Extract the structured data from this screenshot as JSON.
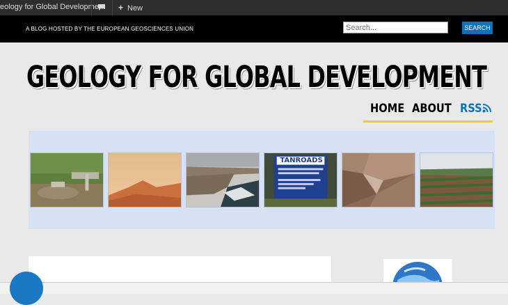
{
  "adminbar": {
    "site_name": "eology for Global Development",
    "comments_icon": "speech-bubble-icon",
    "new_icon": "plus-icon",
    "new_label": "New"
  },
  "header": {
    "tagline": "A BLOG HOSTED BY THE EUROPEAN GEOSCIENCES UNION",
    "search_placeholder": "Search...",
    "search_button": "SEARCH"
  },
  "site": {
    "title": "GEOLOGY FOR GLOBAL DEVELOPMENT"
  },
  "nav": {
    "items": [
      {
        "label": "HOME"
      },
      {
        "label": "ABOUT"
      },
      {
        "label": "RSS"
      }
    ],
    "rss_icon": "rss-feed-icon",
    "underline_color": "#f0d21a"
  },
  "slider": {
    "background": "#d6e2f3",
    "sign_lines": [
      "TANROADS"
    ]
  },
  "colors": {
    "accent": "#0d72b7",
    "header_bg": "#000000",
    "page_bg": "#e9e9e9"
  }
}
